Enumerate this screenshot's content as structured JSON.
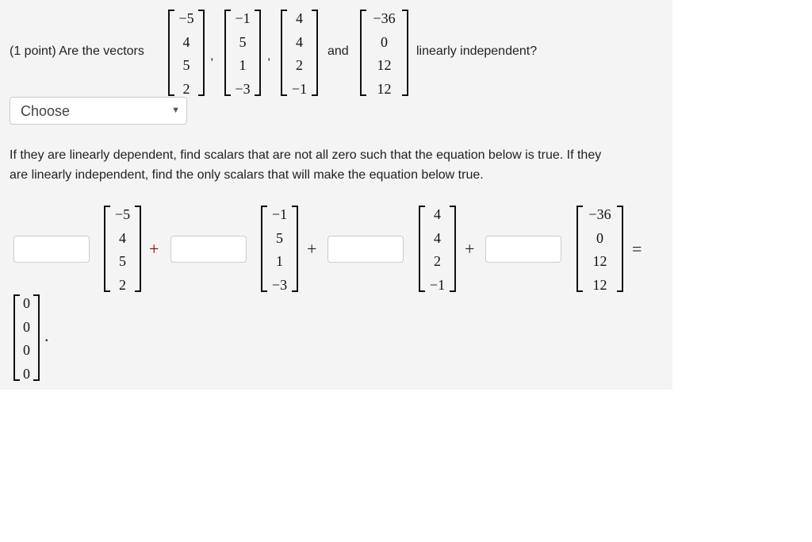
{
  "question": {
    "prefix": "(1 point) Are the vectors",
    "comma": ",",
    "and": "and",
    "suffix": "linearly independent?",
    "vectors": [
      [
        "−5",
        "4",
        "5",
        "2"
      ],
      [
        "−1",
        "5",
        "1",
        "−3"
      ],
      [
        "4",
        "4",
        "2",
        "−1"
      ],
      [
        "−36",
        "0",
        "12",
        "12"
      ]
    ]
  },
  "select": {
    "value": "Choose",
    "arrow_icon": "triangle-down"
  },
  "instructions": {
    "line1": "If they are linearly dependent, find scalars that are not all zero such that the equation below is true. If they",
    "line2": "are linearly independent, find the only scalars that will make the equation below true."
  },
  "equation": {
    "plus": "+",
    "equals": "=",
    "period": ".",
    "zero_vector": [
      "0",
      "0",
      "0",
      "0"
    ]
  },
  "colors": {
    "accent": "#8b0000"
  }
}
